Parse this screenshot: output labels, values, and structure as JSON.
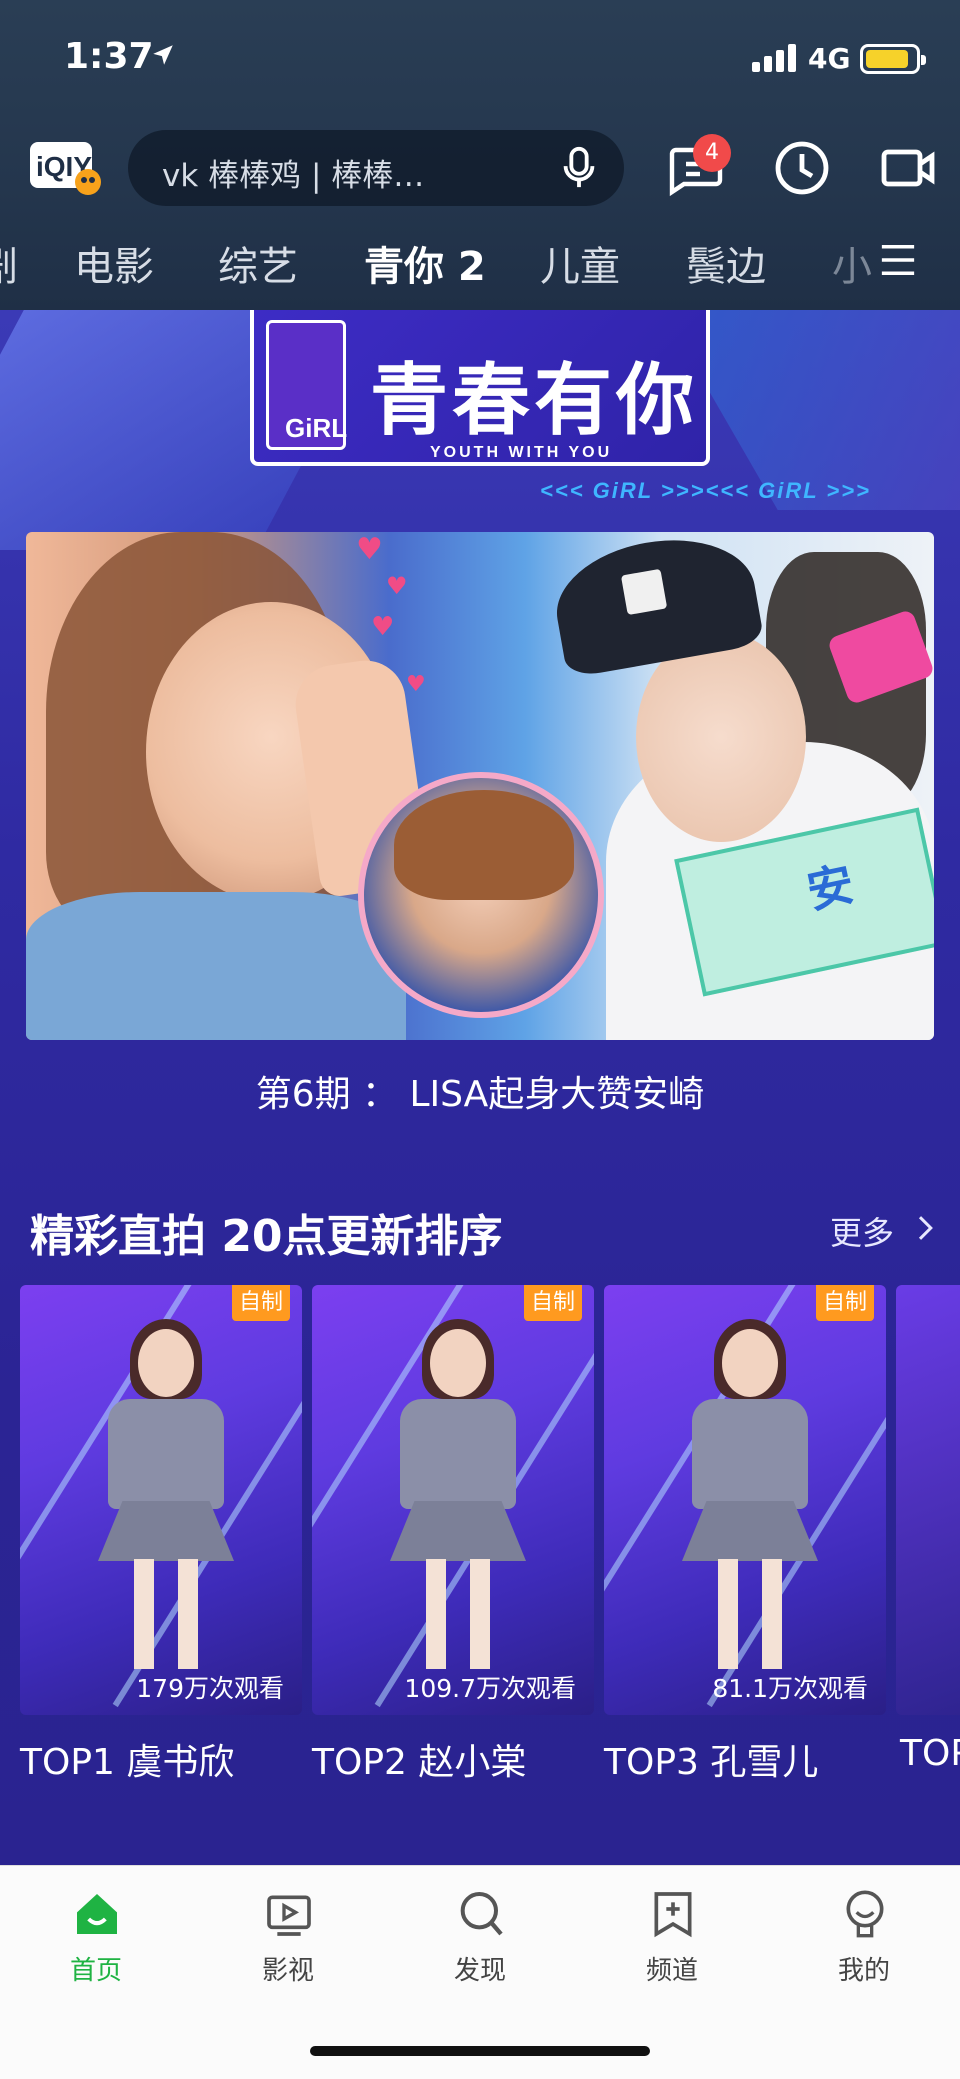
{
  "status": {
    "time": "1:37",
    "network": "4G"
  },
  "header": {
    "search_text": "vk 棒棒鸡 | 棒棒…",
    "notification_count": "4"
  },
  "tabs": [
    "剧",
    "电影",
    "综艺",
    "青你 2",
    "儿童",
    "鬓边",
    "小"
  ],
  "active_tab": "青你 2",
  "banner": {
    "show_title": "青春有你",
    "show_subtitle": "YOUTH WITH YOU",
    "logo_text": "GiRL",
    "strip_text": "<<< GiRL >>><<< GiRL >>>",
    "caption": "第6期 ： LISA起身大赞安崎",
    "tag_text": "安"
  },
  "section": {
    "title": "精彩直拍 20点更新排序",
    "more_label": "更多"
  },
  "cards": [
    {
      "badge": "自制",
      "views": "179万次观看",
      "rank": "TOP1 虞书欣"
    },
    {
      "badge": "自制",
      "views": "109.7万次观看",
      "rank": "TOP2  赵小棠"
    },
    {
      "badge": "自制",
      "views": "81.1万次观看",
      "rank": "TOP3  孔雪儿"
    }
  ],
  "partial_card_rank": "TOP",
  "bottom_nav": [
    {
      "label": "首页",
      "icon": "home-icon",
      "active": true
    },
    {
      "label": "影视",
      "icon": "video-icon",
      "active": false
    },
    {
      "label": "发现",
      "icon": "discover-icon",
      "active": false
    },
    {
      "label": "频道",
      "icon": "channel-icon",
      "active": false
    },
    {
      "label": "我的",
      "icon": "profile-icon",
      "active": false
    }
  ],
  "colors": {
    "accent_green": "#1fb343",
    "badge_orange": "#ff9a1f",
    "notification_red": "#f14a4a",
    "battery_yellow": "#f6d22a",
    "main_purple": "#2a2390"
  }
}
